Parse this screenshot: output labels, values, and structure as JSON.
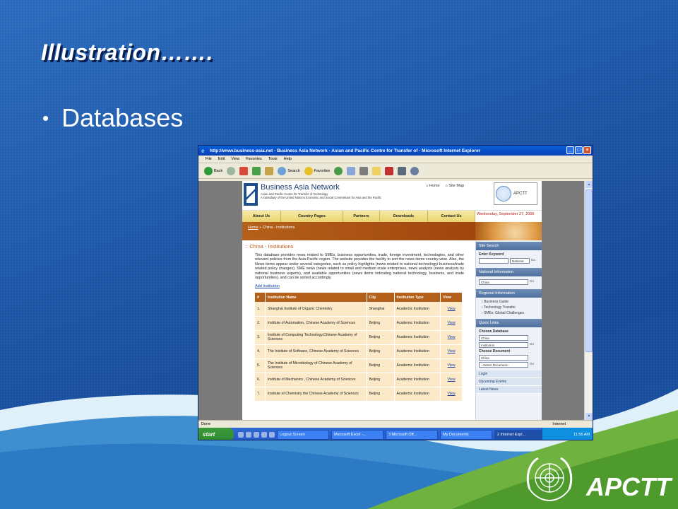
{
  "slide": {
    "title": "Illustration…….",
    "bullet": "Databases",
    "logo_text": "APCTT"
  },
  "browser": {
    "window_title": "http://www.business-asia.net - Business Asia Network - Asian and Pacific Centre for Transfer of - Microsoft Internet Explorer",
    "menu": [
      "File",
      "Edit",
      "View",
      "Favorites",
      "Tools",
      "Help"
    ],
    "toolbar": {
      "back": "Back",
      "search": "Search",
      "favorites": "Favorites"
    },
    "status_left": "Done",
    "status_zone": "Internet"
  },
  "taskbar": {
    "start": "start",
    "tasks": [
      "Logout Screen",
      "Microsoft Excel -...",
      "3 Microsoft Off...",
      "My Documents",
      "2 Internet Expl..."
    ],
    "clock": "11:56 AM"
  },
  "site": {
    "name_a": "Business Asia",
    "name_b": " Network",
    "sub1": "Asian and Pacific Centre for Transfer of Technology",
    "sub2": "A subsidiary of the United Nations Economic and Social Commission for Asia and the Pacific",
    "home_link": "Home",
    "sitemap_link": "Site Map",
    "apctt_label": "APCTT",
    "nav": [
      "About Us",
      "Country Pages",
      "Partners",
      "Downloads",
      "Contact Us"
    ],
    "date": "Wednesday, September 27, 2006",
    "breadcrumb_home": "Home",
    "breadcrumb_rest": " » China - Institutions",
    "heading": ":: China - Institutions",
    "intro": "This database provides news related to SMEs, business opportunities, trade, foreign investment, technologies, and other relevant policies from the Asia-Pacific region. The website provides the facility to sort the news items country-wise. Also, the News items appear under several categories, such as policy highlights (news related to national technology/ business/trade related policy changes), SME news (news related to small and medium scale enterprises, news analysis (news analysis by national business experts), and available opportunities (news items indicating national technology, business, and trade opportunities), and can be sorted accordingly.",
    "add_link": "Add Institution",
    "table_headers": [
      "#",
      "Institution Name",
      "City",
      "Institution Type",
      "View"
    ],
    "rows": [
      [
        "1.",
        "Shanghai Institute of Organic Chemistry",
        "Shanghai",
        "Academic Institution",
        "View"
      ],
      [
        "2.",
        "Institute of Automation, Chinese Academy of Sciences",
        "Beijing",
        "Academic Institution",
        "View"
      ],
      [
        "3.",
        "Institute of Computing Technology,Chinese Academy of Sciences",
        "Beijing",
        "Academic Institution",
        "View"
      ],
      [
        "4.",
        "The Institute of Software, Chinese Academy of Sciences",
        "Beijing",
        "Academic Institution",
        "View"
      ],
      [
        "5.",
        "The Institute of Microbiology of Chinese Academy of Sciences",
        "Beijing",
        "Academic Institution",
        "View"
      ],
      [
        "6.",
        "Institute of Mechanics , Chinese Academy of Sciences",
        "Beijing",
        "Academic Institution",
        "View"
      ],
      [
        "7.",
        "Institute of Chemistry the Chinese Academy of Sciences",
        "Beijing",
        "Academic Institution",
        "View"
      ]
    ],
    "right": {
      "site_search": "Site Search",
      "enter_keyword": "Enter Keyword",
      "national_select": "National",
      "national_info": "National Information",
      "country_select": "China",
      "regional_info": "Regional Information",
      "regional_items": [
        "Business Guide",
        "Technology Transfer",
        "SMEs: Global Challenges"
      ],
      "quick_links": "Quick Links",
      "choose_database": "Choose Database",
      "db_country": "China",
      "db_type": "Institution",
      "choose_document": "Choose Document",
      "doc_country": "China",
      "doc_select": "--Select Document--",
      "login": "Login",
      "upcoming": "Upcoming Events",
      "latest": "Latest News"
    }
  }
}
